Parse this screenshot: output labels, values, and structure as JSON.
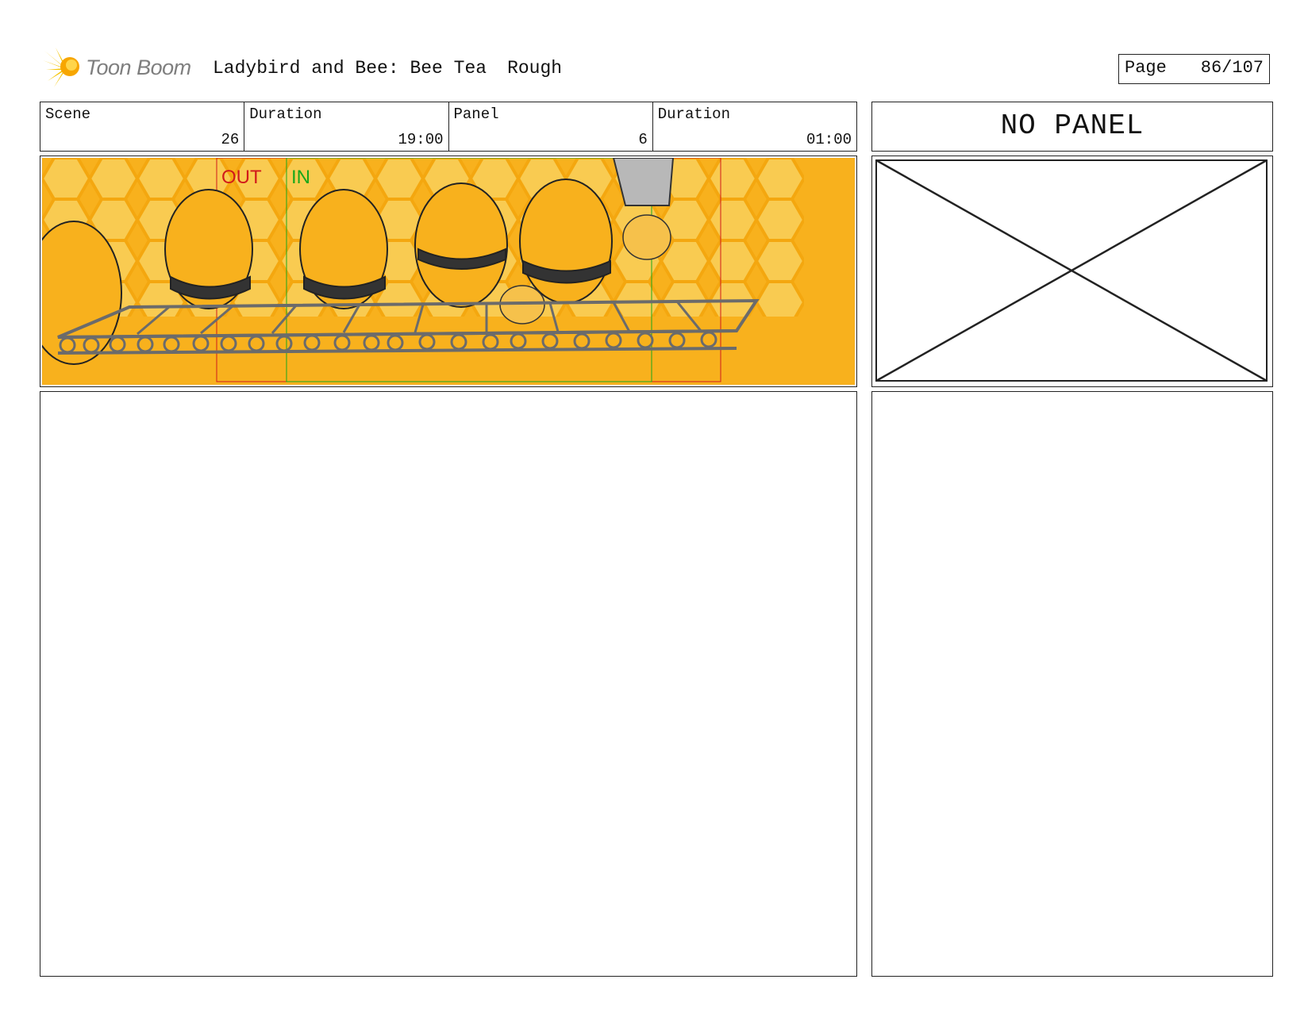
{
  "header": {
    "logo_text": "Toon Boom",
    "project_title": "Ladybird and Bee: Bee Tea",
    "draft_label": "Rough",
    "page_label": "Page",
    "page_number": "86/107"
  },
  "info": {
    "scene_label": "Scene",
    "scene_value": "26",
    "scene_duration_label": "Duration",
    "scene_duration_value": "19:00",
    "panel_label": "Panel",
    "panel_value": "6",
    "panel_duration_label": "Duration",
    "panel_duration_value": "01:00"
  },
  "next_panel": {
    "label": "NO PANEL"
  },
  "artwork": {
    "out_marker": "OUT",
    "in_marker": "IN",
    "colors": {
      "background": "#f8b11d",
      "honeycomb": "#f9cf5a",
      "conveyor": "#6b6b6b",
      "out_marker": "#d11a1a",
      "in_marker": "#1aa81a"
    }
  }
}
